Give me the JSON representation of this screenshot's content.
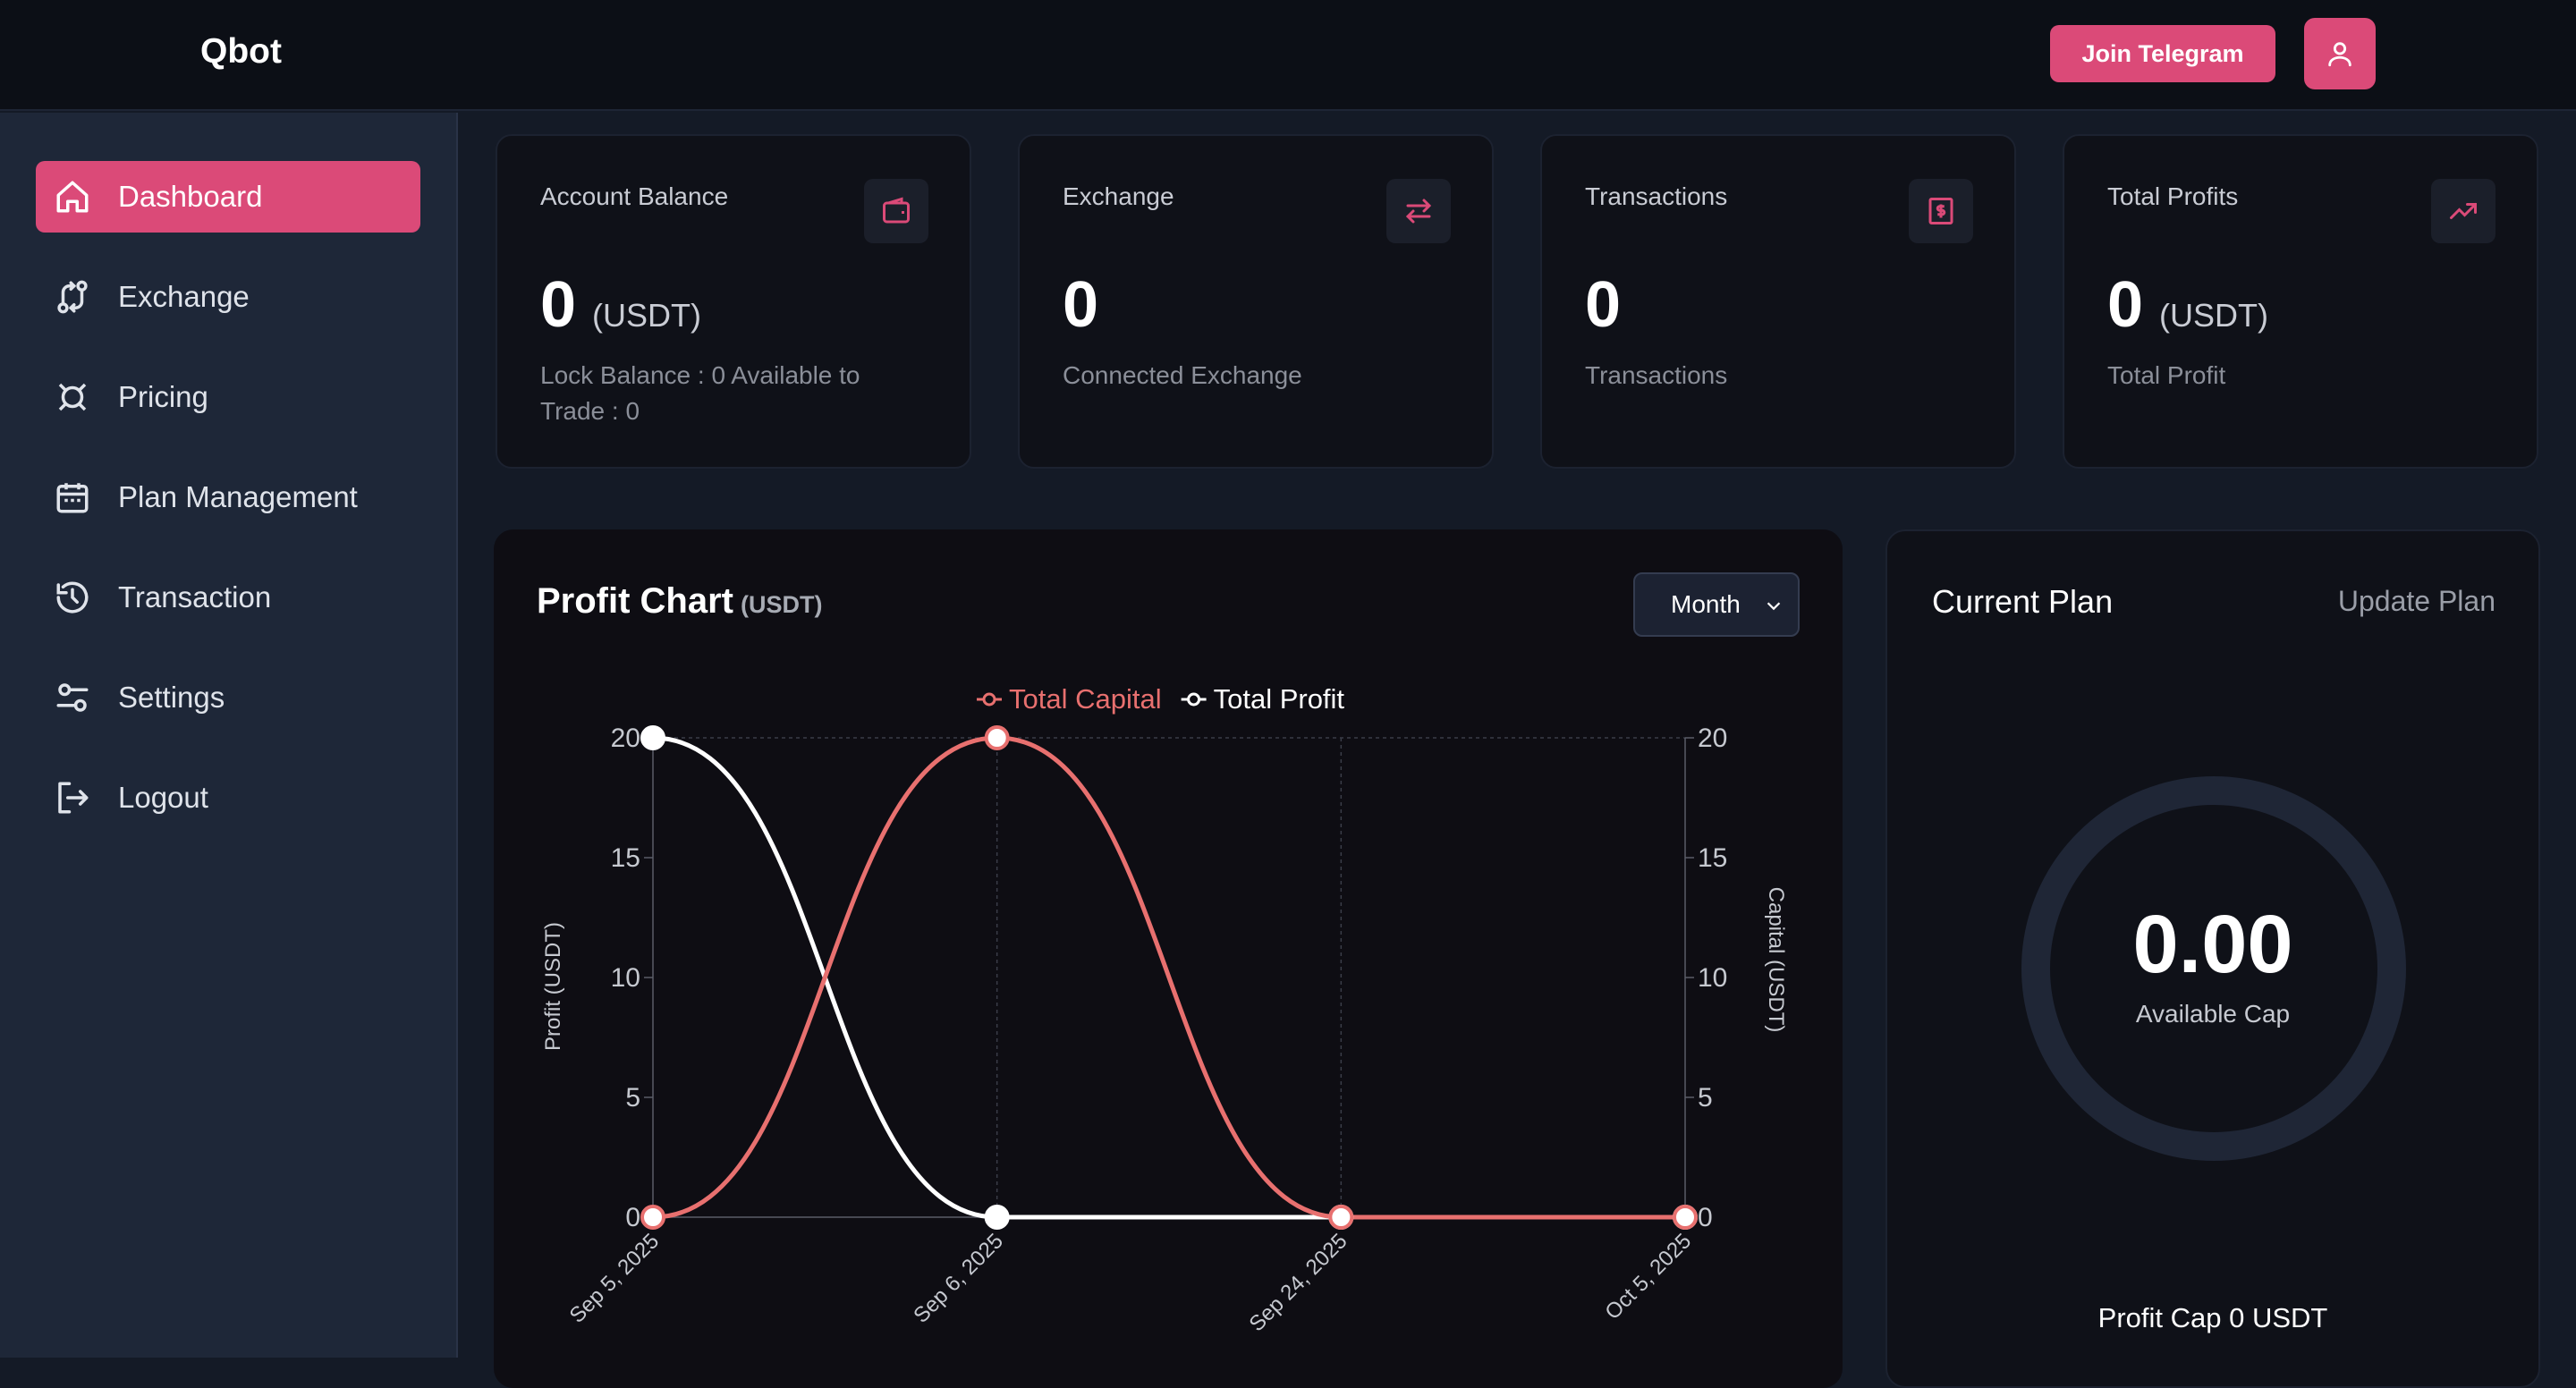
{
  "header": {
    "brand": "Qbot",
    "telegram_label": "Join Telegram"
  },
  "sidebar": {
    "items": [
      {
        "label": "Dashboard",
        "icon": "home-icon",
        "active": true
      },
      {
        "label": "Exchange",
        "icon": "exchange-icon"
      },
      {
        "label": "Pricing",
        "icon": "pricing-icon"
      },
      {
        "label": "Plan Management",
        "icon": "calendar-icon"
      },
      {
        "label": "Transaction",
        "icon": "history-icon"
      },
      {
        "label": "Settings",
        "icon": "settings-icon"
      },
      {
        "label": "Logout",
        "icon": "logout-icon"
      }
    ]
  },
  "cards": [
    {
      "title": "Account Balance",
      "value": "0",
      "unit": "(USDT)",
      "sub": "Lock Balance : 0 Available to Trade : 0",
      "icon": "wallet-icon"
    },
    {
      "title": "Exchange",
      "value": "0",
      "unit": "",
      "sub": "Connected Exchange",
      "icon": "arrows-icon"
    },
    {
      "title": "Transactions",
      "value": "0",
      "unit": "",
      "sub": "Transactions",
      "icon": "receipt-icon"
    },
    {
      "title": "Total Profits",
      "value": "0",
      "unit": "(USDT)",
      "sub": "Total Profit",
      "icon": "trending-up-icon"
    }
  ],
  "profit_chart": {
    "title": "Profit Chart",
    "unit": "(USDT)",
    "period": "Month"
  },
  "chart_data": {
    "type": "line",
    "x": [
      "Sep 5, 2025",
      "Sep 6, 2025",
      "Sep 24, 2025",
      "Oct 5, 2025"
    ],
    "series": [
      {
        "name": "Total Capital",
        "axis": "right",
        "color": "#e8706f",
        "values": [
          0,
          20,
          0,
          0
        ]
      },
      {
        "name": "Total Profit",
        "axis": "left",
        "color": "#ffffff",
        "values": [
          20,
          0,
          0,
          0
        ]
      }
    ],
    "ylabel": "Profit (USDT)",
    "y2label": "Capital (USDT)",
    "ylim": [
      0,
      20
    ],
    "yticks": [
      0,
      5,
      10,
      15,
      20
    ],
    "legend": "top-center"
  },
  "plan": {
    "title": "Current Plan",
    "update_label": "Update Plan",
    "available_cap": "0.00",
    "available_label": "Available Cap",
    "profit_cap": "Profit Cap 0 USDT"
  },
  "colors": {
    "accent": "#db4a78",
    "capital": "#e8706f",
    "profit": "#ffffff"
  }
}
